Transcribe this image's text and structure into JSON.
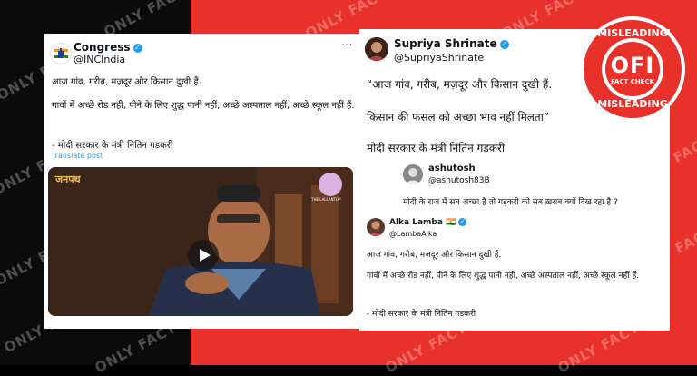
{
  "watermark": "ONLY FACT",
  "left_tweet": {
    "name": "Congress",
    "handle": "@INCIndia",
    "line1": "आज गांव, गरीब, मज़दूर और किसान दुखी हैं.",
    "line2": "गावों में अच्छे रोड नहीं, पीने के लिए शुद्ध पानी नहीं, अच्छे अस्पताल नहीं, अच्छे स्कूल नहीं हैं.",
    "line3": "- मोदी सरकार के मंत्री नितिन गडकरी",
    "translate": "Translate post",
    "more": "···",
    "video_logo": "जनपथ",
    "video_channel": "THE LALLANTOP"
  },
  "right_tweet": {
    "name": "Supriya Shrinate",
    "handle": "@SupriyaShrinate",
    "line1": "“आज गांव, गरीब, मज़दूर और किसान दुखी हैं.",
    "line2": "किसान की फसल को अच्छा भाव नहीं मिलता”",
    "line3": "मोदी सरकार के मंत्री नितिन गडकरी",
    "more": "···"
  },
  "quote1": {
    "name": "ashutosh",
    "handle": "@ashutosh83B",
    "text": "मोदी के राज में सब अच्छा है तो गड़करी को सब ख़राब क्यों दिख रहा है ?"
  },
  "quote2": {
    "name": "Alka Lamba",
    "flag": "🇮🇳",
    "handle": "@LambaAlka",
    "line1": "आज गांव, गरीब, मज़दूर और किसान दुखी हैं.",
    "line2": "गावों में अच्छे रोड नहीं, पीने के लिए शुद्ध पानी नहीं, अच्छे अस्पताल नहीं, अच्छे स्कूल नहीं हैं.",
    "line3": "- मोदी सरकार के मंत्री नितिन गडकरी"
  },
  "badge": {
    "top": "MISLEADING",
    "logo": "OFI",
    "sub": "FACT CHECK",
    "bottom": "MISLEADING"
  },
  "colors": {
    "brand_red": "#e8312a",
    "twitter_blue": "#1d9bf0"
  }
}
